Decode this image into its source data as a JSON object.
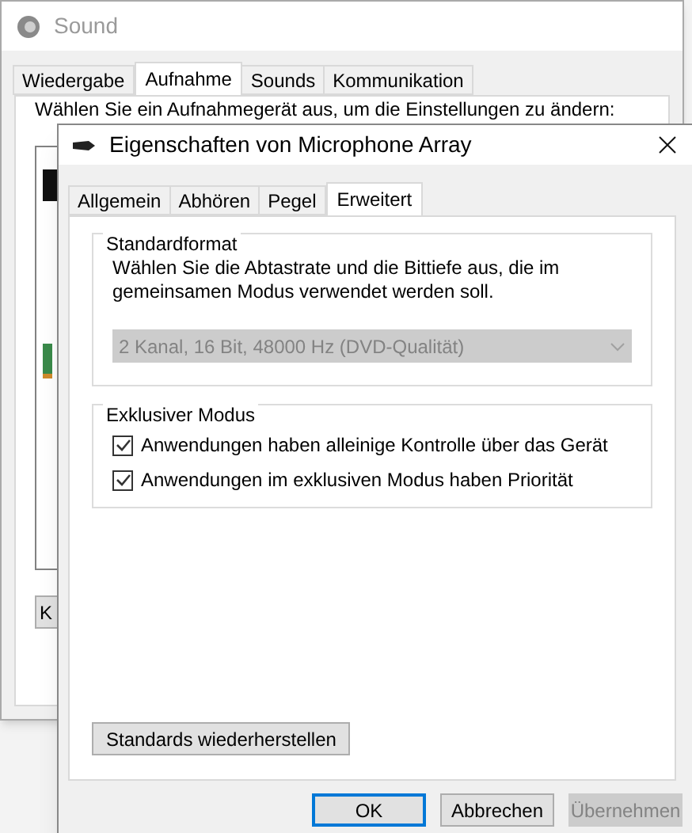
{
  "background_window": {
    "title": "Sound",
    "tabs": [
      {
        "label": "Wiedergabe",
        "selected": false
      },
      {
        "label": "Aufnahme",
        "selected": true
      },
      {
        "label": "Sounds",
        "selected": false
      },
      {
        "label": "Kommunikation",
        "selected": false
      }
    ],
    "instruction": "Wählen Sie ein Aufnahmegerät aus, um die Einstellungen zu ändern:",
    "button_1": "K"
  },
  "dialog": {
    "title": "Eigenschaften von Microphone Array",
    "tabs": [
      {
        "label": "Allgemein",
        "selected": false
      },
      {
        "label": "Abhören",
        "selected": false
      },
      {
        "label": "Pegel",
        "selected": false
      },
      {
        "label": "Erweitert",
        "selected": true
      }
    ],
    "groups": [
      {
        "kind": "format",
        "title": "Standardformat",
        "description": "Wählen Sie die Abtastrate und die Bittiefe aus, die im gemeinsamen Modus verwendet werden soll.",
        "dropdown": {
          "value": "2 Kanal, 16 Bit, 48000 Hz (DVD-Qualität)",
          "disabled": true
        }
      },
      {
        "kind": "checks",
        "title": "Exklusiver Modus",
        "options": [
          {
            "label": "Anwendungen haben alleinige Kontrolle über das Gerät",
            "checked": true
          },
          {
            "label": "Anwendungen im exklusiven Modus haben Priorität",
            "checked": true
          }
        ]
      }
    ],
    "restore_button": "Standards wiederherstellen",
    "buttons": [
      {
        "label": "OK",
        "default": true,
        "disabled": false
      },
      {
        "label": "Abbrechen",
        "default": false,
        "disabled": false
      },
      {
        "label": "Übernehmen",
        "default": false,
        "disabled": true
      }
    ]
  }
}
